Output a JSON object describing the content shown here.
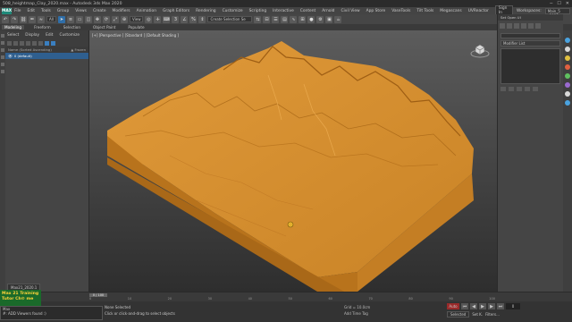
{
  "titlebar": {
    "title": "508_heightmap_Clay_2020.max - Autodesk 3ds Max 2020",
    "min": "─",
    "max": "☐",
    "close": "✕"
  },
  "menubar": {
    "logo": "MAX",
    "items": [
      "File",
      "Edit",
      "Tools",
      "Group",
      "Views",
      "Create",
      "Modifiers",
      "Animation",
      "Graph Editors",
      "Rendering",
      "Customize",
      "Scripting",
      "Interactive",
      "Content",
      "Arnold",
      "Civil View",
      "App Store",
      "VaseTools",
      "Tilt Tools",
      "Megascans",
      "UVReactor"
    ],
    "sign_in": "Sign In",
    "workspaces_label": "Workspaces:",
    "workspace_value": "Main_5 _2020"
  },
  "toolbar": {
    "filter_value": "All",
    "selection_set_placeholder": "Create Selection Se",
    "view_value": "View"
  },
  "ribbon": {
    "tabs": [
      "Modeling",
      "Freeform",
      "Selection",
      "Object Paint",
      "Populate"
    ],
    "active": 0
  },
  "explorer": {
    "tabs": [
      "Select",
      "Display",
      "Edit",
      "Customize"
    ],
    "header_name": "Name (Sorted Ascending)",
    "header_frozen": "▲ Frozen",
    "rows": [
      {
        "label": "0 (default)",
        "selected": true
      }
    ],
    "layer_value": "Max21_2020.1"
  },
  "viewport": {
    "label": "[+] [Perspective ] [Standard ] [Default Shading ]"
  },
  "command_panel": {
    "workspace_row": "Set Open UI"
  },
  "timeline": {
    "slider": "0 / 100",
    "ticks": [
      "0",
      "10",
      "20",
      "30",
      "40",
      "50",
      "60",
      "70",
      "80",
      "90",
      "100"
    ]
  },
  "watermark": {
    "line1": "Max 21 Training",
    "line2": "Tutor Ch⚙ me"
  },
  "maxscript": {
    "line1": "Max",
    "line2": "#: ADD Viewers found :)"
  },
  "status": {
    "line1": "None Selected",
    "line2": "Click or click-and-drag to select objects"
  },
  "grid": {
    "value": "Grid = 10.0cm",
    "addtime": "Add Time Tag"
  },
  "animation": {
    "frame": "0",
    "auto_key": "Auto",
    "selected": "Selected",
    "set_key": "Set K.",
    "filters": "Filters..."
  },
  "colors": {
    "terrain": "#d08a2a",
    "accent": "#2f6ea8",
    "watermark_bg": "#1a6a2a"
  }
}
